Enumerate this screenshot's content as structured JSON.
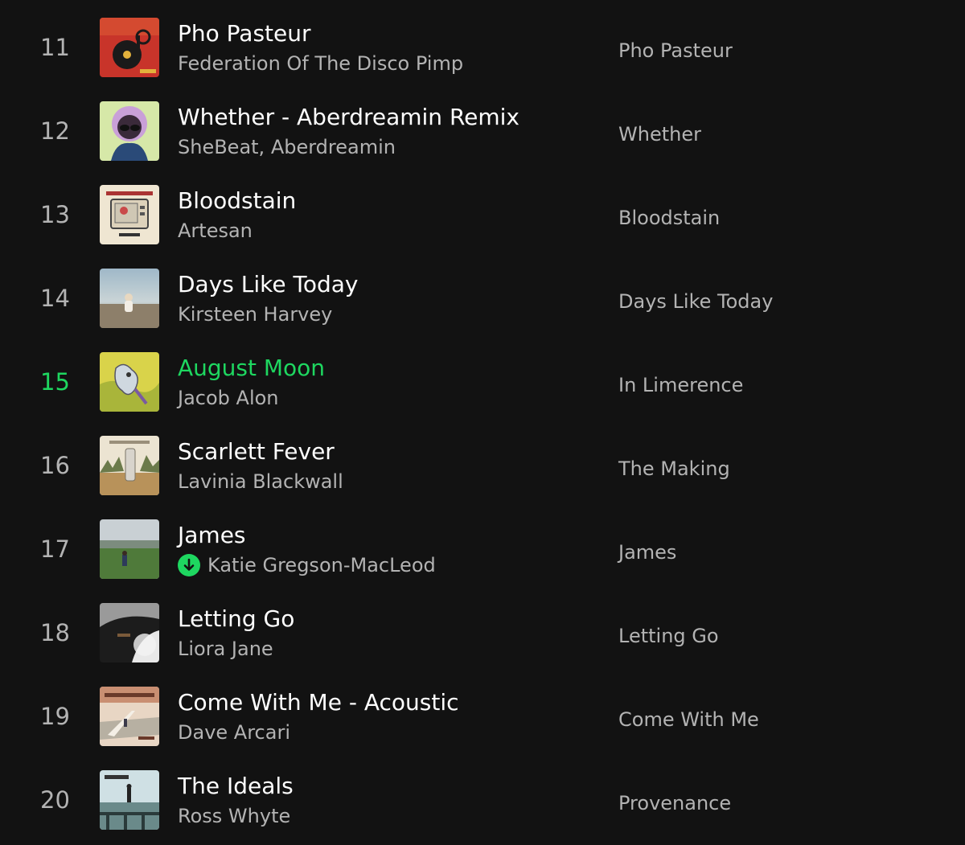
{
  "colors": {
    "background": "#121212",
    "primary_text": "#ffffff",
    "secondary_text": "#b3b3b3",
    "accent_playing": "#1ed760"
  },
  "tracks": [
    {
      "number": "11",
      "title": "Pho Pasteur",
      "artist": "Federation Of The Disco Pimp",
      "album": "Pho Pasteur",
      "playing": false,
      "downloaded": false
    },
    {
      "number": "12",
      "title": "Whether - Aberdreamin Remix",
      "artist": "SheBeat, Aberdreamin",
      "album": "Whether",
      "playing": false,
      "downloaded": false
    },
    {
      "number": "13",
      "title": "Bloodstain",
      "artist": "Artesan",
      "album": "Bloodstain",
      "playing": false,
      "downloaded": false
    },
    {
      "number": "14",
      "title": "Days Like Today",
      "artist": "Kirsteen Harvey",
      "album": "Days Like Today",
      "playing": false,
      "downloaded": false
    },
    {
      "number": "15",
      "title": "August Moon",
      "artist": "Jacob Alon",
      "album": "In Limerence",
      "playing": true,
      "downloaded": false
    },
    {
      "number": "16",
      "title": "Scarlett Fever",
      "artist": "Lavinia Blackwall",
      "album": "The Making",
      "playing": false,
      "downloaded": false
    },
    {
      "number": "17",
      "title": "James",
      "artist": "Katie Gregson-MacLeod",
      "album": "James",
      "playing": false,
      "downloaded": true
    },
    {
      "number": "18",
      "title": "Letting Go",
      "artist": "Liora Jane",
      "album": "Letting Go",
      "playing": false,
      "downloaded": false
    },
    {
      "number": "19",
      "title": "Come With Me - Acoustic",
      "artist": "Dave Arcari",
      "album": "Come With Me",
      "playing": false,
      "downloaded": false
    },
    {
      "number": "20",
      "title": "The Ideals",
      "artist": "Ross Whyte",
      "album": "Provenance",
      "playing": false,
      "downloaded": false
    }
  ]
}
